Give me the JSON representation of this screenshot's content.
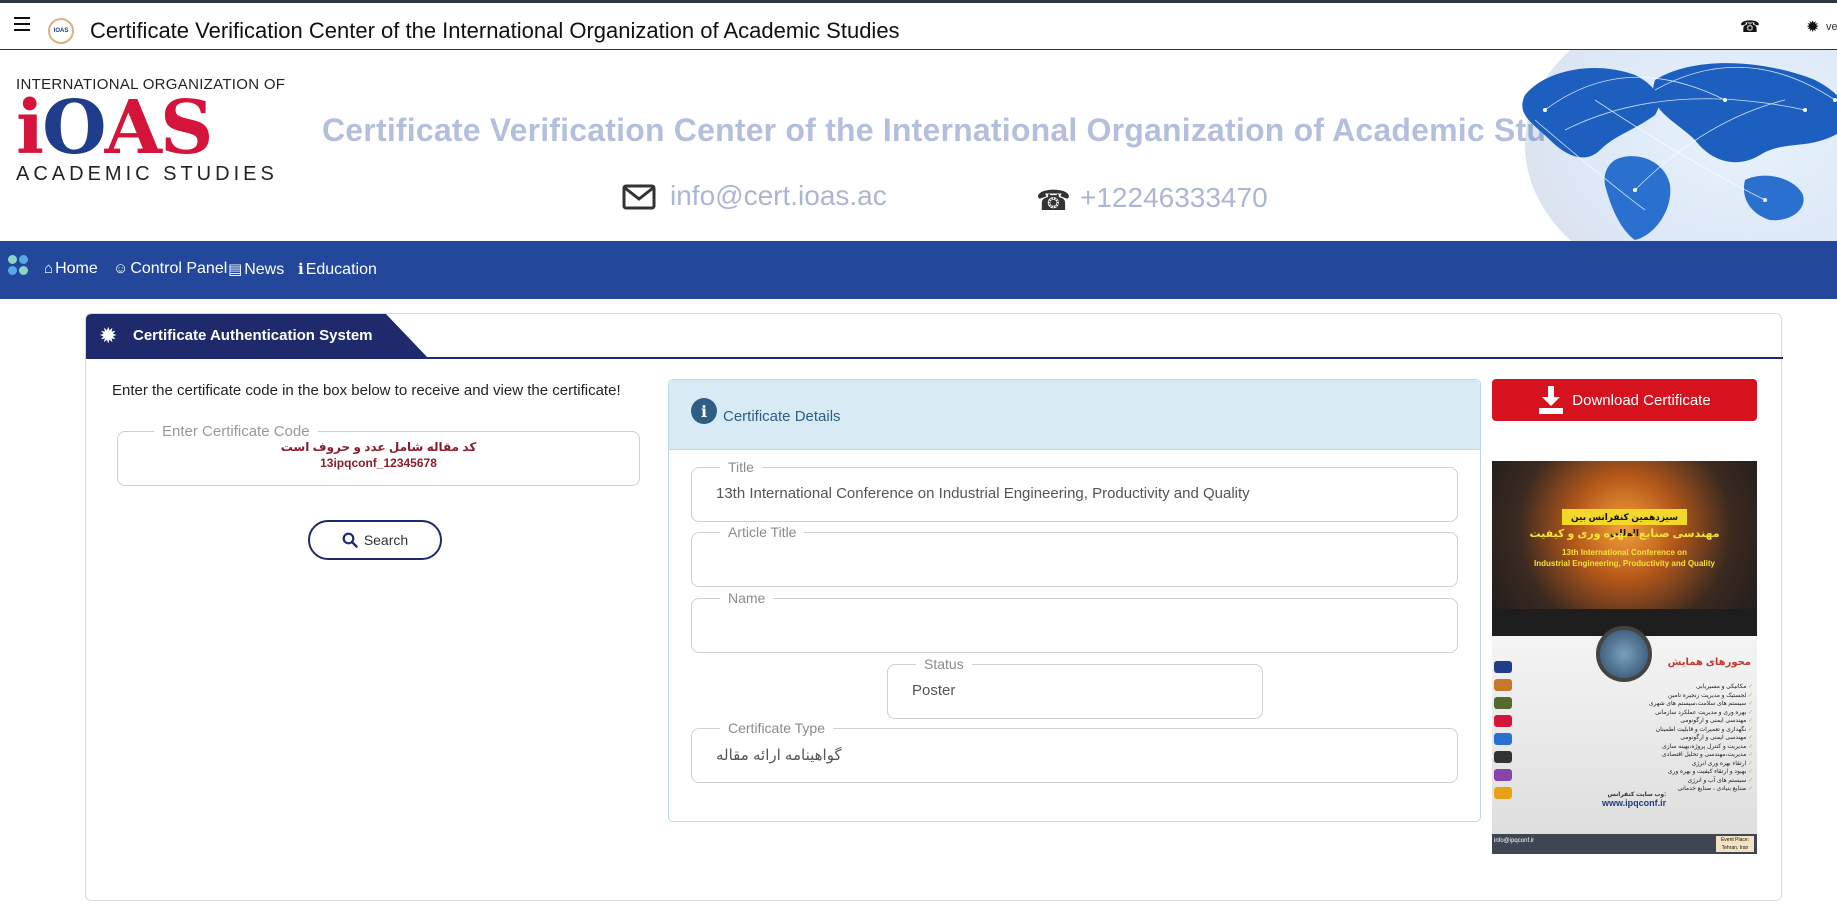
{
  "topbar": {
    "title": "Certificate Verification Center of the International Organization of Academic Studies",
    "logo_text": "IOAS",
    "truncated_right_text": "ve"
  },
  "banner": {
    "logo_top": "INTERNATIONAL ORGANIZATION OF",
    "logo_letters_1": "i",
    "logo_letters_2": "O",
    "logo_letters_3": "AS",
    "logo_bottom": "ACADEMIC STUDIES",
    "title": "Certificate Verification Center of the International Organization of Academic Studies",
    "email": "info@cert.ioas.ac",
    "phone": "+12246333470"
  },
  "nav": {
    "items": [
      {
        "label": "Home",
        "icon": "home-icon"
      },
      {
        "label": "Control Panel",
        "icon": "user-icon"
      },
      {
        "label": "News",
        "icon": "newspaper-icon"
      },
      {
        "label": "Education",
        "icon": "info-icon"
      }
    ]
  },
  "card": {
    "tab_label": "Certificate Authentication System",
    "instructions": "Enter the certificate code in the box below to receive and view the certificate!",
    "code_field": {
      "legend": "Enter Certificate Code",
      "hint_line1": "کد مقاله شامل عدد و حروف است",
      "hint_line2": "13ipqconf_12345678"
    },
    "search_label": "Search"
  },
  "details": {
    "title": "Certificate Details",
    "fields": {
      "title": {
        "label": "Title",
        "value": "13th International Conference on Industrial Engineering, Productivity and Quality"
      },
      "article_title": {
        "label": "Article Title",
        "value": ""
      },
      "name": {
        "label": "Name",
        "value": ""
      },
      "status": {
        "label": "Status",
        "value": "Poster"
      },
      "certificate_type": {
        "label": "Certificate Type",
        "value": "گواهینامه ارائه مقاله"
      }
    }
  },
  "download": {
    "label": "Download Certificate"
  },
  "poster": {
    "fa_line1": "سیزدهمین کنفرانس بین المللی",
    "fa_line2": "مهندسی صنایع ، بهره وری و کیفیت",
    "en_line1": "13th International Conference on",
    "en_line2": "Industrial Engineering, Productivity and Quality",
    "topics_heading": "محورهای همایش",
    "topics": [
      "مکانیکی و مسیریابی",
      "لجستیک و مدیریت زنجیره تامین",
      "سیستم های سلامت،سیستم های شهری",
      "بهره وری و مدیریت عملکرد سازمانی",
      "مهندسی ایمنی و ارگونومی",
      "نگهداری و تعمیرات و قابلیت اطمینان",
      "مهندسی ایمنی و ارگونومی",
      "مدیریت و کنترل پروژه،بهینه سازی",
      "مدیریت،مهندسی و تحلیل اقتصادی",
      "ارتقاء بهره وری انرژی",
      "بهبود و ارتقاء کیفیت و بهره وری",
      "سیستم های آب و انرژی",
      "صنایع بنیادی ، صنایع خدماتی"
    ],
    "website_label": "وب سایت کنفرانس:",
    "website": "www.ipqconf.ir",
    "footer_email": "info@ipqconf.ir",
    "footer_place": "Event Place: Tehran, Iran"
  },
  "colors": {
    "nav_bg": "#23479a",
    "accent_dark": "#1e2a6b",
    "download_red": "#d7121f",
    "details_head": "#d8ebf5"
  }
}
